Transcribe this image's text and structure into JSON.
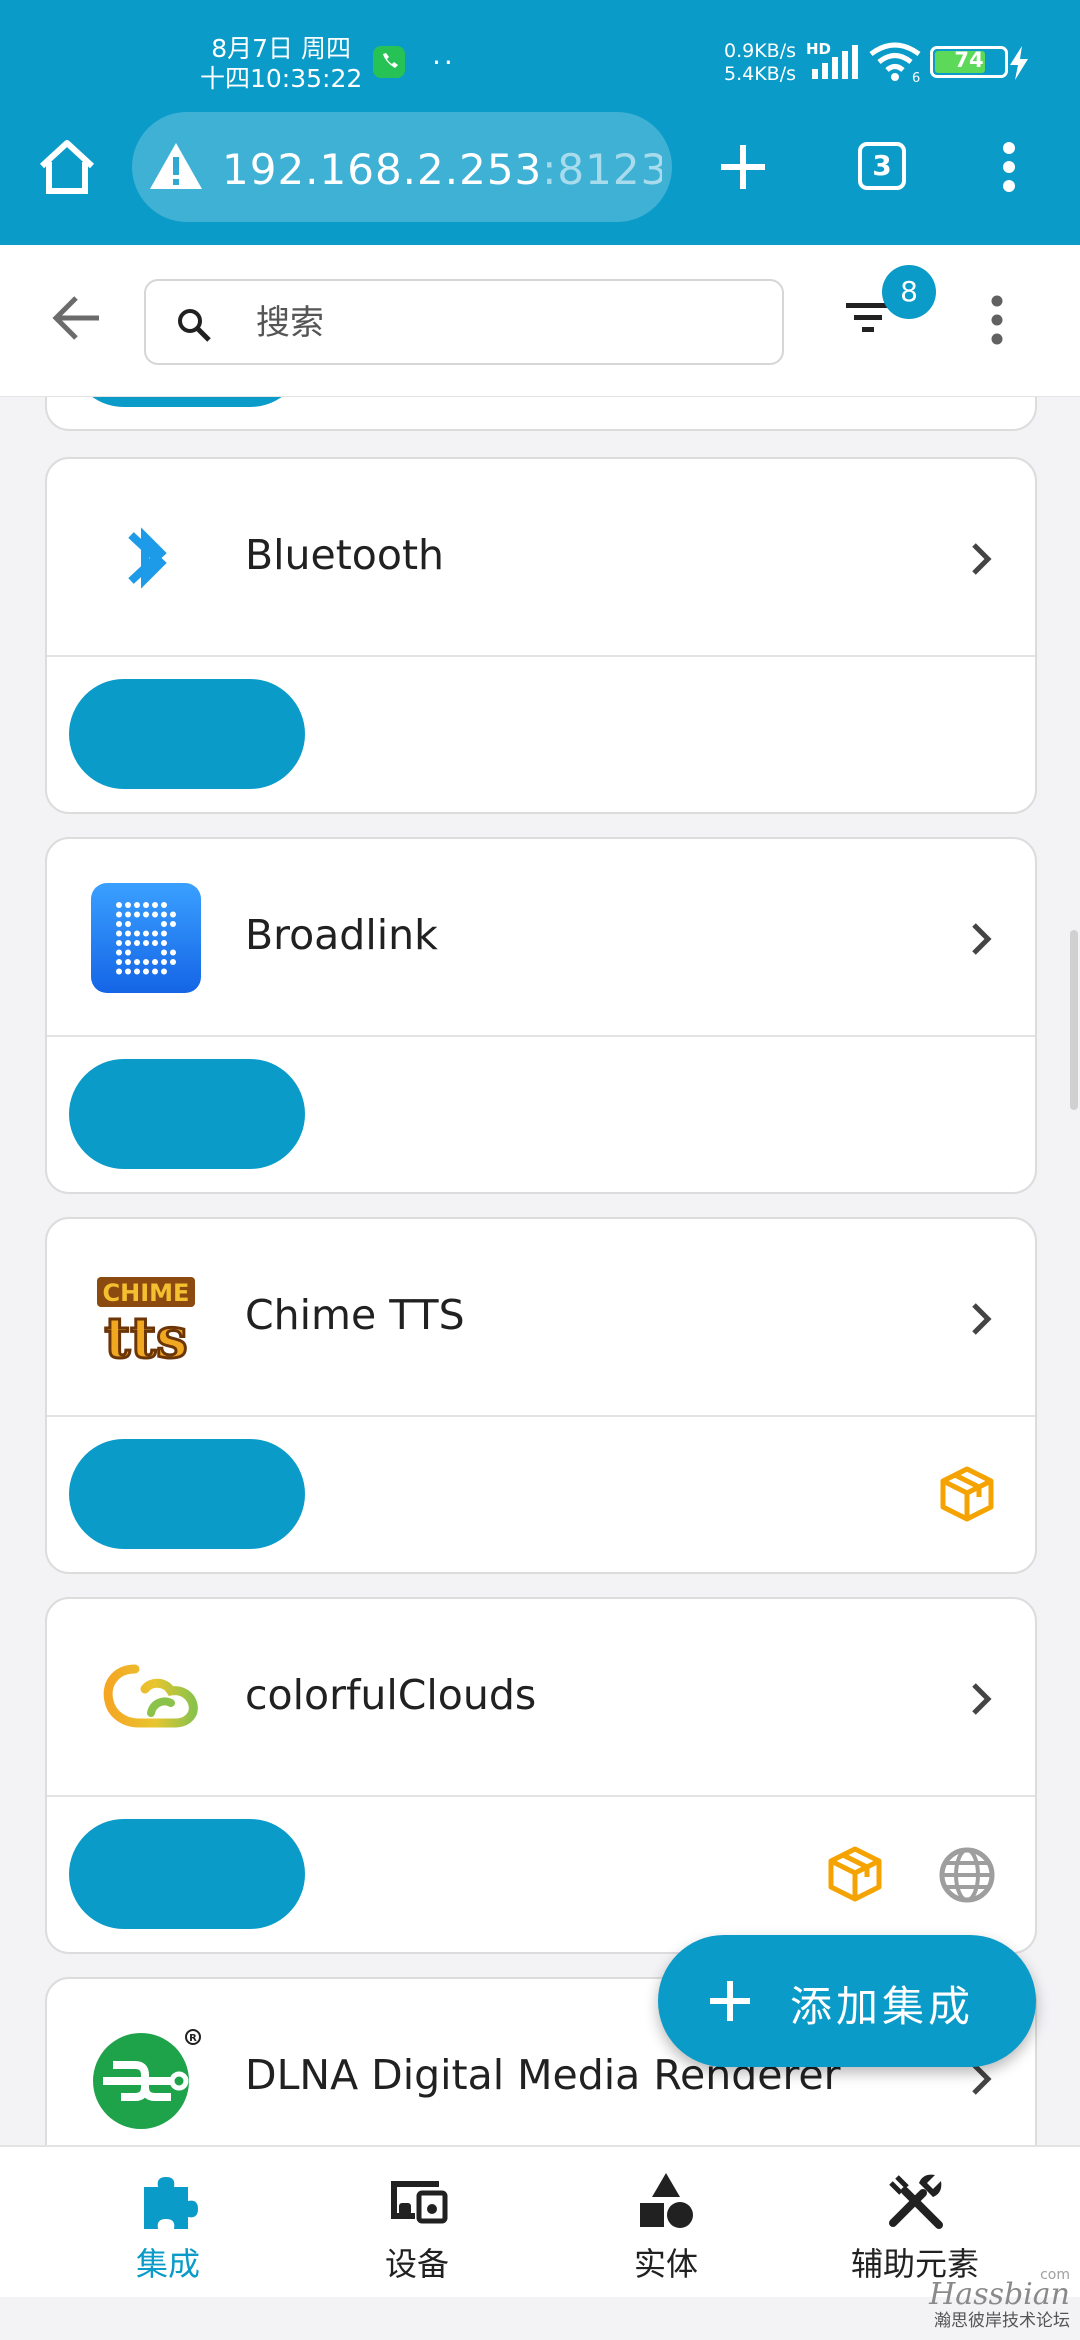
{
  "status_bar": {
    "date": "8月7日 周四",
    "time": "十四10:35:22",
    "dots": "··",
    "net_up": "0.9KB/s",
    "net_down": "5.4KB/s",
    "hd": "HD",
    "wifi_sub": "6",
    "battery": "74",
    "battery_fraction": 0.74
  },
  "browser": {
    "url_host": "192.168.2.253",
    "url_port": ":8123/",
    "tab_count": "3"
  },
  "toolbar": {
    "search_placeholder": "搜索",
    "filter_count": "8"
  },
  "integrations": [
    {
      "name": "Bluetooth",
      "badges": []
    },
    {
      "name": "Broadlink",
      "badges": []
    },
    {
      "name": "Chime TTS",
      "badges": [
        "custom-integration-icon"
      ]
    },
    {
      "name": "colorfulClouds",
      "badges": [
        "custom-integration-icon",
        "cloud-globe-icon"
      ]
    },
    {
      "name": "DLNA Digital Media Renderer",
      "badges": []
    }
  ],
  "chime_logo": {
    "top": "CHIME",
    "bottom": "tts"
  },
  "fab": {
    "label": "添加集成"
  },
  "bottom_nav": [
    {
      "label": "集成",
      "icon": "puzzle-icon",
      "active": true
    },
    {
      "label": "设备",
      "icon": "devices-icon",
      "active": false
    },
    {
      "label": "实体",
      "icon": "shapes-icon",
      "active": false
    },
    {
      "label": "辅助元素",
      "icon": "tools-icon",
      "active": false
    }
  ],
  "watermark": {
    "brand": "Hassbian",
    "sub": "瀚思彼岸技术论坛",
    "com": "com"
  },
  "colors": {
    "accent": "#0a9bc9",
    "orange": "#f5a300",
    "grey": "#9e9e9e"
  }
}
